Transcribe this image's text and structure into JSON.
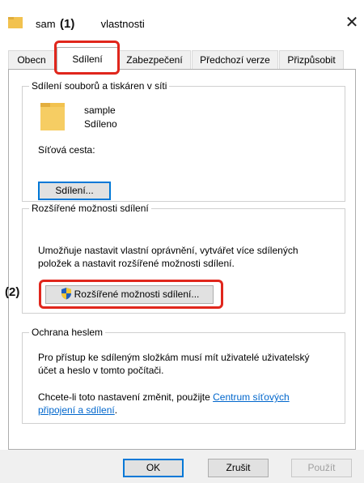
{
  "window": {
    "title_left": "sam",
    "title_right": "vlastnosti",
    "close_glyph": "✕"
  },
  "tabs": [
    {
      "label": "Obecn"
    },
    {
      "label": "Sdílení",
      "active": true
    },
    {
      "label": "Zabezpečení"
    },
    {
      "label": "Předchozí verze"
    },
    {
      "label": "Přizpůsobit"
    }
  ],
  "network_sharing": {
    "legend": "Sdílení souborů a tiskáren v síti",
    "folder_name": "sample",
    "folder_status": "Sdíleno",
    "path_label": "Síťová cesta:",
    "share_button": "Sdílení..."
  },
  "advanced_sharing": {
    "legend": "Rozšířené možnosti sdílení",
    "description_line1": "Umožňuje nastavit vlastní oprávnění, vytvářet více sdílených",
    "description_line2": "položek a nastavit rozšířené možnosti sdílení.",
    "button": "Rozšířené možnosti sdílení..."
  },
  "password_protection": {
    "legend": "Ochrana heslem",
    "line1": "Pro přístup ke sdíleným složkám musí mít uživatelé uživatelský",
    "line2": "účet a heslo v tomto počítači.",
    "line3_prefix": "Chcete-li toto nastavení změnit, použijte ",
    "link_part1": "Centrum síťových",
    "link_part2": "připojení a sdílení",
    "line4_suffix": "."
  },
  "footer": {
    "ok": "OK",
    "cancel": "Zrušit",
    "apply": "Použít"
  },
  "annotations": {
    "callout_1": "(1)",
    "callout_2": "(2)",
    "highlight_color": "#e0261c"
  },
  "colors": {
    "folder": "#f2c24f",
    "link": "#0066cc",
    "default_button_border": "#0078d7"
  }
}
